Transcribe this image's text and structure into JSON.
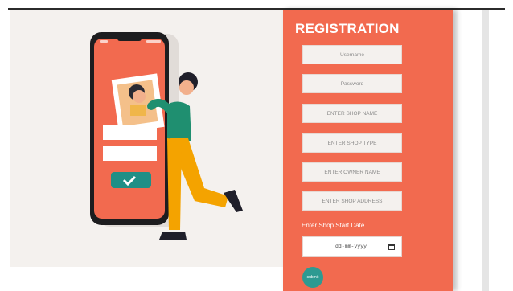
{
  "registration": {
    "title": "REGISTRATION",
    "username_placeholder": "Username",
    "password_placeholder": "Password",
    "shop_name_placeholder": "ENTER SHOP NAME",
    "shop_type_placeholder": "ENTER SHOP TYPE",
    "owner_name_placeholder": "ENTER OWNER NAME",
    "shop_address_placeholder": "ENTER SHOP ADDRESS",
    "start_date_label": "Enter Shop Start Date",
    "date_placeholder": "dd-mm-yyyy",
    "submit_label": "submit"
  },
  "colors": {
    "panel": "#f26a4f",
    "submit": "#2e9a91",
    "illustration_bg": "#f4f1ee"
  }
}
